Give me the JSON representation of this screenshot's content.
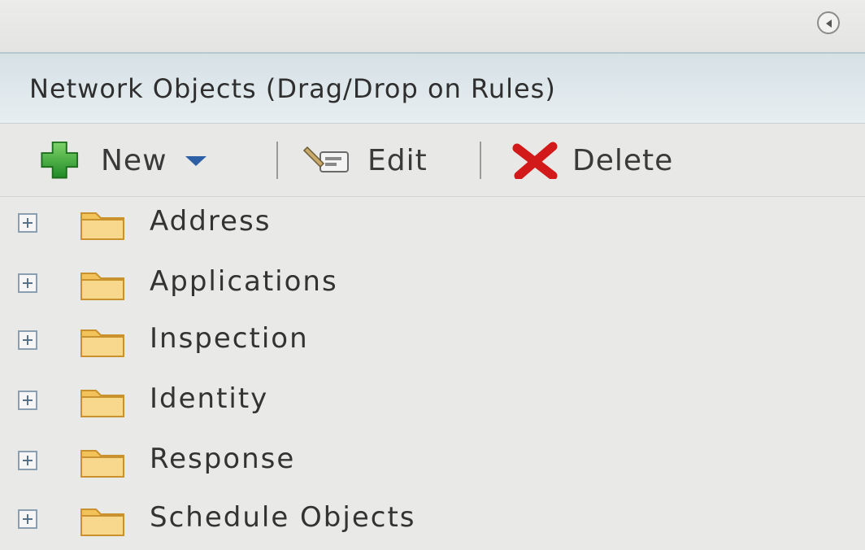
{
  "panel": {
    "title": "Network Objects (Drag/Drop on Rules)"
  },
  "toolbar": {
    "new_label": "New",
    "edit_label": "Edit",
    "delete_label": "Delete"
  },
  "icons": {
    "new": "plus-icon",
    "new_menu": "chevron-down-icon",
    "edit": "edit-icon",
    "delete": "delete-x-icon",
    "collapse": "collapse-panel-icon",
    "expander": "expand-plus-icon",
    "folder": "folder-icon"
  },
  "colors": {
    "new_icon": "#2e9a2e",
    "delete_icon": "#d21a1a",
    "folder": "#f2c35a",
    "new_arrow": "#2d5fa5"
  },
  "tree": {
    "items": [
      {
        "label": "Address"
      },
      {
        "label": "Applications"
      },
      {
        "label": "Inspection"
      },
      {
        "label": "Identity"
      },
      {
        "label": "Response"
      },
      {
        "label": "Schedule Objects"
      }
    ]
  }
}
